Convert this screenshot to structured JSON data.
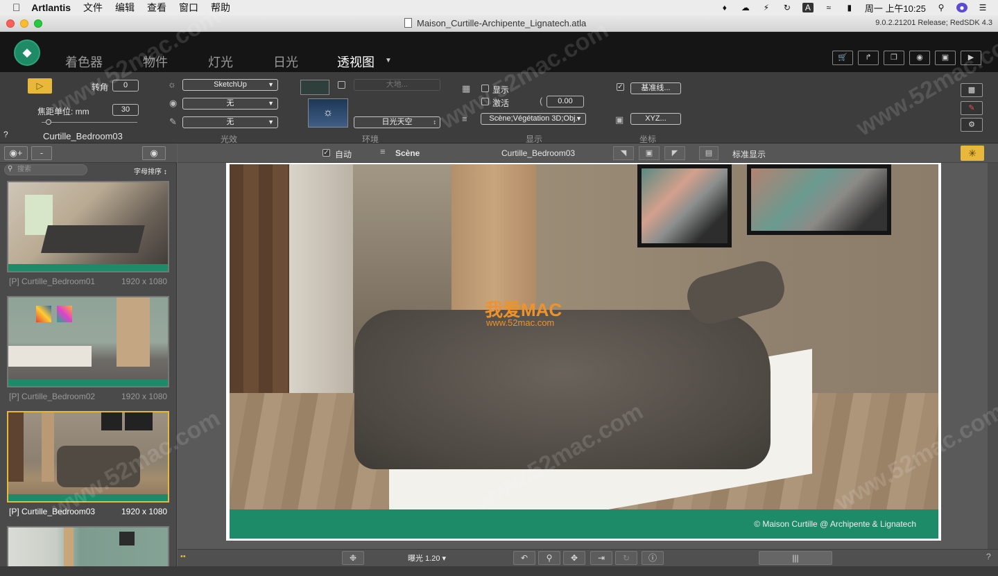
{
  "menubar": {
    "app_name": "Artlantis",
    "items": [
      "文件",
      "编辑",
      "查看",
      "窗口",
      "帮助"
    ],
    "clock": "周一 上午10:25"
  },
  "window": {
    "title": "Maison_Curtille-Archipente_Lignatech.atla",
    "version": "9.0.2.21201 Release; RedSDK 4.3"
  },
  "tabs": [
    "着色器",
    "物件",
    "灯光",
    "日光",
    "透视图"
  ],
  "panel": {
    "rotation_label": "转角",
    "rotation_value": "0",
    "focal_label": "焦距单位: mm",
    "focal_value": "30",
    "view_name": "Curtille_Bedroom03",
    "help": "?",
    "lighting": {
      "dropdown1": "SketchUp",
      "dropdown2": "无",
      "dropdown3": "无",
      "section": "光效"
    },
    "environment": {
      "ground_button": "大地...",
      "sky_select": "日光天空",
      "section": "环境"
    },
    "display": {
      "show_label": "显示",
      "activate_label": "激活",
      "value": "0.00",
      "layers_select": "Scène;Végétation 3D;Obj.",
      "section": "显示"
    },
    "coords": {
      "baseline_button": "基准线...",
      "xyz_button": "XYZ...",
      "section": "坐标"
    }
  },
  "sidebar": {
    "search_placeholder": "搜索",
    "sort_label": "字母排序",
    "remove_label": "-",
    "items": [
      {
        "name": "[P] Curtille_Bedroom01",
        "resolution": "1920 x 1080"
      },
      {
        "name": "[P] Curtille_Bedroom02",
        "resolution": "1920 x 1080"
      },
      {
        "name": "[P] Curtille_Bedroom03",
        "resolution": "1920 x 1080"
      }
    ]
  },
  "viewtool": {
    "auto_label": "自动",
    "scene_label": "Scène",
    "view_title": "Curtille_Bedroom03",
    "display_mode": "标准显示"
  },
  "render": {
    "credit": "© Maison Curtille @ Archipente & Lignatech",
    "watermark_brand": "我爱MAC",
    "watermark_url": "www.52mac.com"
  },
  "bottom": {
    "exposure": "曝光 1.20",
    "left_dots": "••",
    "help": "?"
  },
  "watermark_text": "www.52mac.com",
  "colors": {
    "accent_green": "#1d8a68",
    "selection_gold": "#e7b83a"
  }
}
